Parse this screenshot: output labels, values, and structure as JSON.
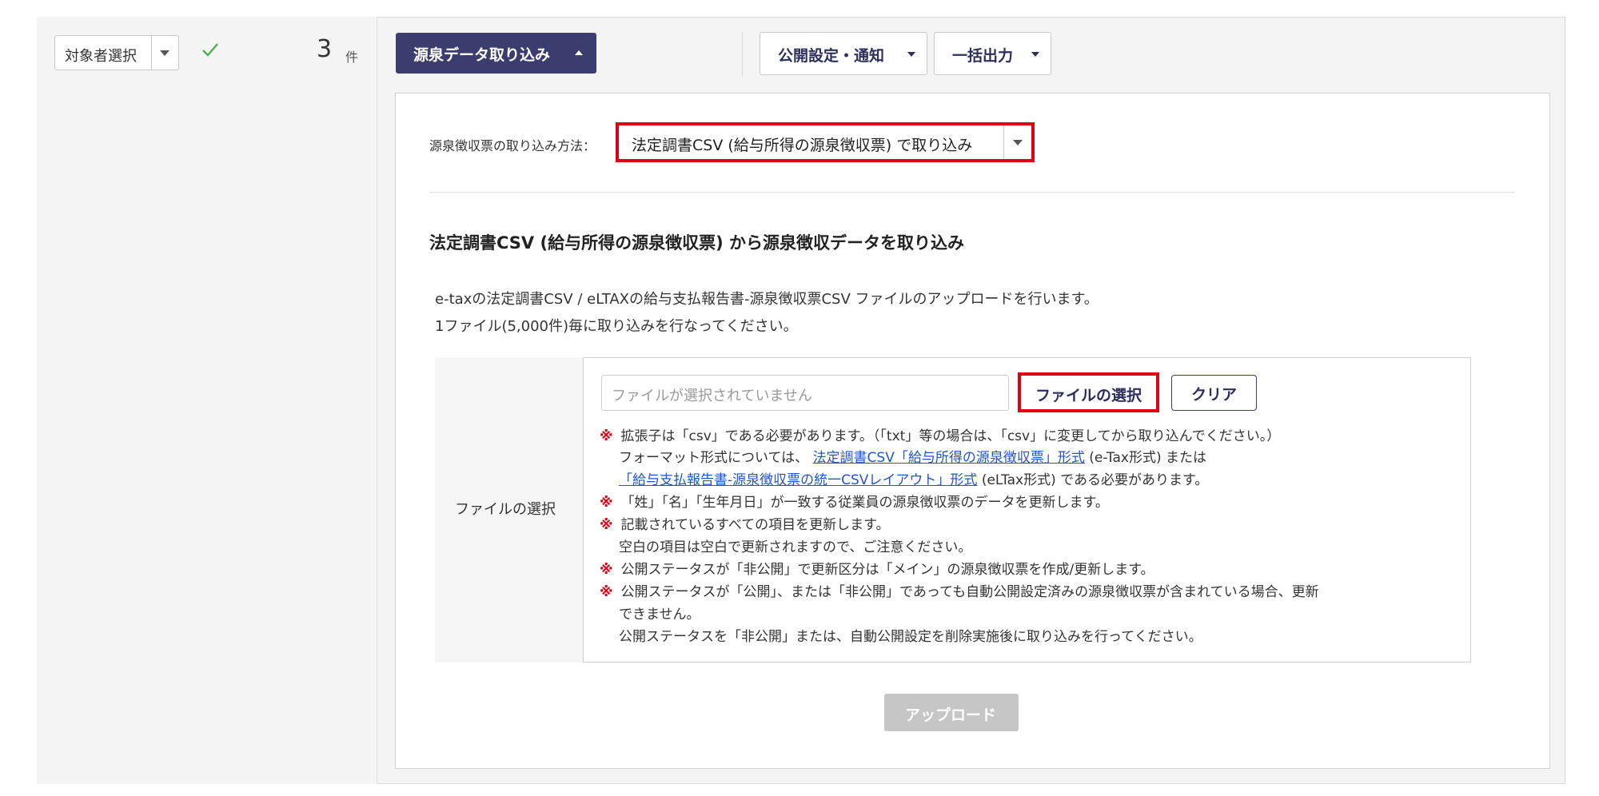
{
  "sidebar": {
    "target_select_label": "対象者選択",
    "count": "3",
    "count_unit": "件"
  },
  "toolbar": {
    "import_label": "源泉データ取り込み",
    "publish_label": "公開設定・通知",
    "export_label": "一括出力"
  },
  "import_method": {
    "label": "源泉徴収票の取り込み方法：",
    "selected": "法定調書CSV (給与所得の源泉徴収票) で取り込み"
  },
  "section": {
    "title": "法定調書CSV (給与所得の源泉徴収票) から源泉徴収データを取り込み",
    "desc_1": "e-taxの法定調書CSV / eLTAXの給与支払報告書-源泉徴収票CSV ファイルのアップロードを行います。",
    "desc_2": "1ファイル(5,000件)毎に取り込みを行なってください。"
  },
  "file": {
    "row_label": "ファイルの選択",
    "placeholder": "ファイルが選択されていません",
    "select_button": "ファイルの選択",
    "clear_button": "クリア"
  },
  "notes": {
    "mark": "※",
    "n1": "拡張子は「csv」である必要があります。（「txt」等の場合は、「csv」に変更してから取り込んでください。）",
    "n1_prefix": "フォーマット形式については、",
    "n1_link1": "法定調書CSV「給与所得の源泉徴収票」形式",
    "n1_mid": "(e-Tax形式) または",
    "n1_link2": "「給与支払報告書-源泉徴収票の統一CSVレイアウト」形式",
    "n1_suffix": "(eLTax形式) である必要があります。",
    "n2": "「姓」「名」「生年月日」が一致する従業員の源泉徴収票のデータを更新します。",
    "n3": "記載されているすべての項目を更新します。",
    "n3_cont": "空白の項目は空白で更新されますので、ご注意ください。",
    "n4": "公開ステータスが「非公開」で更新区分は「メイン」の源泉徴収票を作成/更新します。",
    "n5": "公開ステータスが「公開」、または「非公開」であっても自動公開設定済みの源泉徴収票が含まれている場合、更新",
    "n5_cont1": "できません。",
    "n5_cont2": "公開ステータスを「非公開」または、自動公開設定を削除実施後に取り込みを行ってください。"
  },
  "upload_label": "アップロード",
  "colors": {
    "primary": "#3b3d6e",
    "highlight_border": "#e00012",
    "check": "#4caf50",
    "link": "#2255cc",
    "disabled": "#c6c6c6"
  }
}
